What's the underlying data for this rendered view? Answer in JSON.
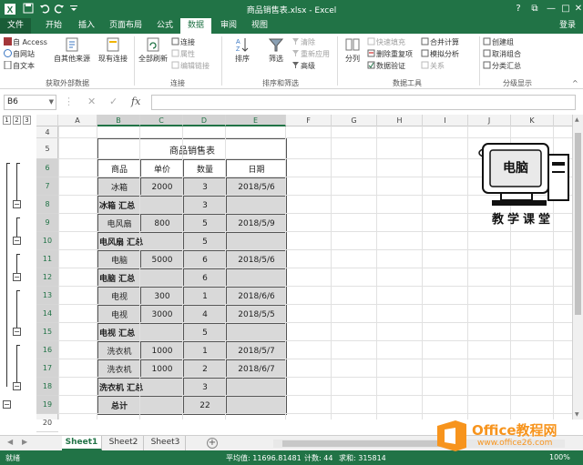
{
  "window": {
    "title": "商品销售表.xlsx - Excel",
    "min_glyph": "—",
    "max_glyph": "□",
    "close_glyph": "✕",
    "restore_glyph": "⧉",
    "help_glyph": "?"
  },
  "ribbon_tabs": [
    "文件",
    "开始",
    "插入",
    "页面布局",
    "公式",
    "数据",
    "审阅",
    "视图"
  ],
  "active_tab": "数据",
  "login_label": "登录",
  "ribbon": {
    "get_external": {
      "items": [
        "自 Access",
        "自网站",
        "自文本"
      ],
      "other_sources": "自其他来源",
      "existing": "现有连接",
      "group_label": "获取外部数据"
    },
    "connections": {
      "refresh_all": "全部刷新",
      "items": [
        "连接",
        "属性",
        "编辑链接"
      ],
      "group_label": "连接"
    },
    "sort_filter": {
      "sort": "排序",
      "filter": "筛选",
      "items": [
        "清除",
        "重新应用",
        "高级"
      ],
      "group_label": "排序和筛选"
    },
    "data_tools": {
      "split": "分列",
      "items": [
        "快速填充",
        "删除重复项",
        "数据验证",
        "合并计算",
        "模拟分析",
        "关系"
      ],
      "group_label": "数据工具"
    },
    "outline": {
      "items": [
        "创建组",
        "取消组合",
        "分类汇总"
      ],
      "group_label": "分级显示"
    }
  },
  "formula_bar": {
    "name_box": "B6",
    "cancel_glyph": "✕",
    "enter_glyph": "✓",
    "fx_glyph": "fx",
    "formula": ""
  },
  "outline_levels": [
    "1",
    "2",
    "3"
  ],
  "outline_collapse_glyph": "−",
  "column_headers": [
    "A",
    "B",
    "C",
    "D",
    "E",
    "F",
    "G",
    "H",
    "I",
    "J",
    "K",
    "L"
  ],
  "selected_columns": [
    "B",
    "C",
    "D",
    "E"
  ],
  "row_numbers": [
    "4",
    "5",
    "6",
    "7",
    "8",
    "9",
    "10",
    "11",
    "12",
    "13",
    "14",
    "15",
    "16",
    "17",
    "18",
    "19",
    "20",
    "21"
  ],
  "selected_rows": [
    "6",
    "7",
    "8",
    "9",
    "10",
    "11",
    "12",
    "13",
    "14",
    "15",
    "16",
    "17",
    "18",
    "19"
  ],
  "table": {
    "title": "商品销售表",
    "headers": [
      "商品",
      "单价",
      "数量",
      "日期"
    ],
    "rows": [
      {
        "type": "data",
        "cells": [
          "冰箱",
          "2000",
          "3",
          "2018/5/6"
        ]
      },
      {
        "type": "subtotal",
        "label": "冰箱 汇总",
        "qty": "3"
      },
      {
        "type": "data",
        "cells": [
          "电风扇",
          "800",
          "5",
          "2018/5/9"
        ]
      },
      {
        "type": "subtotal",
        "label": "电风扇 汇总",
        "qty": "5"
      },
      {
        "type": "data",
        "cells": [
          "电脑",
          "5000",
          "6",
          "2018/5/6"
        ]
      },
      {
        "type": "subtotal",
        "label": "电脑 汇总",
        "qty": "6"
      },
      {
        "type": "data",
        "cells": [
          "电视",
          "300",
          "1",
          "2018/6/6"
        ]
      },
      {
        "type": "data",
        "cells": [
          "电视",
          "3000",
          "4",
          "2018/5/5"
        ]
      },
      {
        "type": "subtotal",
        "label": "电视 汇总",
        "qty": "5"
      },
      {
        "type": "data",
        "cells": [
          "洗衣机",
          "1000",
          "1",
          "2018/5/7"
        ]
      },
      {
        "type": "data",
        "cells": [
          "洗衣机",
          "1000",
          "2",
          "2018/6/7"
        ]
      },
      {
        "type": "subtotal",
        "label": "洗衣机 汇总",
        "qty": "3"
      },
      {
        "type": "total",
        "label": "总计",
        "qty": "22"
      }
    ]
  },
  "logo": {
    "screen_text": "电脑",
    "caption": "教学课堂"
  },
  "sheet_tabs": [
    "Sheet1",
    "Sheet2",
    "Sheet3"
  ],
  "active_sheet": "Sheet1",
  "add_sheet_glyph": "+",
  "status": {
    "ready": "就绪",
    "average": "平均值: 11696.81481",
    "count": "计数: 44",
    "sum": "求和: 315814",
    "zoom": "100%"
  },
  "watermark": {
    "brand": "Office教程网",
    "url": "www.office26.com"
  },
  "colors": {
    "excel_green": "#217346",
    "shade": "#d9d9d9",
    "watermark_orange": "#f7941d"
  }
}
